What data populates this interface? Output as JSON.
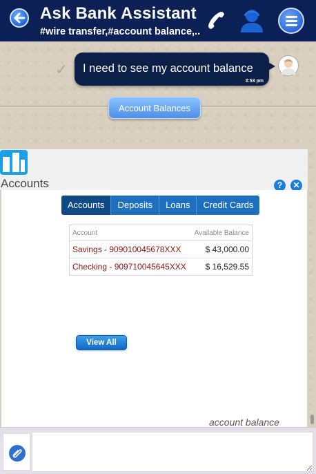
{
  "header": {
    "title": "Ask Bank Assistant",
    "subtitle": "#wire transfer,#account balance,...",
    "icons": {
      "back": "back-arrow-icon",
      "phone": "phone-icon",
      "agent": "agent-icon",
      "menu": "hamburger-menu-icon"
    },
    "colors": {
      "bar": "#0b2156",
      "button": "#2d68d9"
    }
  },
  "chat": {
    "user_message": "I need to see my account balance",
    "user_message_time": "3:53 pm",
    "quick_reply_label": "Account Balances",
    "trailing_text": "account balance"
  },
  "accounts_widget": {
    "title": "Accounts",
    "tabs": [
      {
        "label": "Accounts",
        "active": true
      },
      {
        "label": "Deposits",
        "active": false
      },
      {
        "label": "Loans",
        "active": false
      },
      {
        "label": "Credit Cards",
        "active": false
      }
    ],
    "table": {
      "columns": [
        "Account",
        "Available Balance"
      ],
      "rows": [
        {
          "account": "Savings - 909010045678XXX",
          "balance": "$ 43,000.00"
        },
        {
          "account": "Checking - 909710045645XXX",
          "balance": "$ 16,529.55"
        }
      ]
    },
    "view_all_label": "View All",
    "colors": {
      "tab": "#1e6fbd",
      "tab_active": "#0f4a86",
      "account_text": "#8b1414"
    }
  },
  "composer": {
    "placeholder": "",
    "attach_icon": "paperclip-icon"
  }
}
